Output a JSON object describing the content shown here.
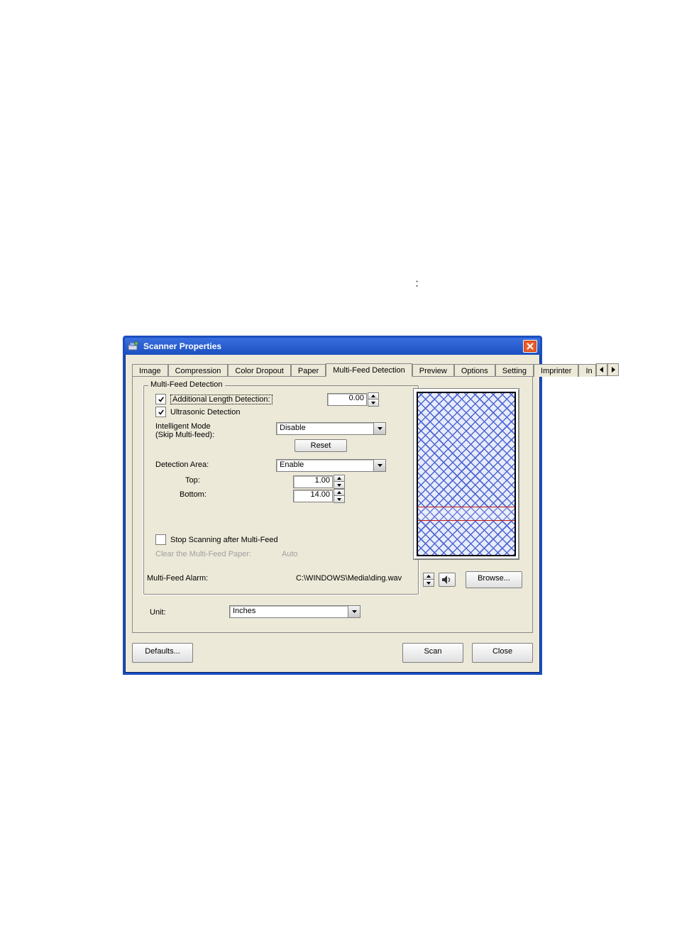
{
  "window": {
    "title": "Scanner Properties"
  },
  "tabs": {
    "items": [
      "Image",
      "Compression",
      "Color Dropout",
      "Paper",
      "Multi-Feed Detection",
      "Preview",
      "Options",
      "Setting",
      "Imprinter",
      "In"
    ],
    "selected_index": 4
  },
  "group": {
    "legend": "Multi-Feed Detection",
    "additional_length": {
      "label": "Additional Length Detection:",
      "checked": true,
      "value": "0.00"
    },
    "ultrasonic": {
      "label": "Ultrasonic Detection",
      "checked": true
    },
    "intelligent_mode": {
      "label_line1": "Intelligent Mode",
      "label_line2": "(Skip Multi-feed):",
      "value": "Disable"
    },
    "reset_btn": "Reset",
    "detection_area": {
      "label": "Detection Area:",
      "value": "Enable",
      "top_label": "Top:",
      "top_value": "1.00",
      "bottom_label": "Bottom:",
      "bottom_value": "14.00"
    },
    "stop_scanning": {
      "label": "Stop Scanning after Multi-Feed",
      "checked": false
    },
    "clear_paper": {
      "label": "Clear the Multi-Feed Paper:",
      "value": "Auto"
    }
  },
  "alarm": {
    "label": "Multi-Feed Alarm:",
    "path": "C:\\WINDOWS\\Media\\ding.wav",
    "browse": "Browse..."
  },
  "unit": {
    "label": "Unit:",
    "value": "Inches"
  },
  "buttons": {
    "defaults": "Defaults...",
    "scan": "Scan",
    "close": "Close"
  },
  "icons": {
    "close": "close-icon",
    "app": "scanner-app-icon",
    "speaker": "speaker-icon"
  }
}
